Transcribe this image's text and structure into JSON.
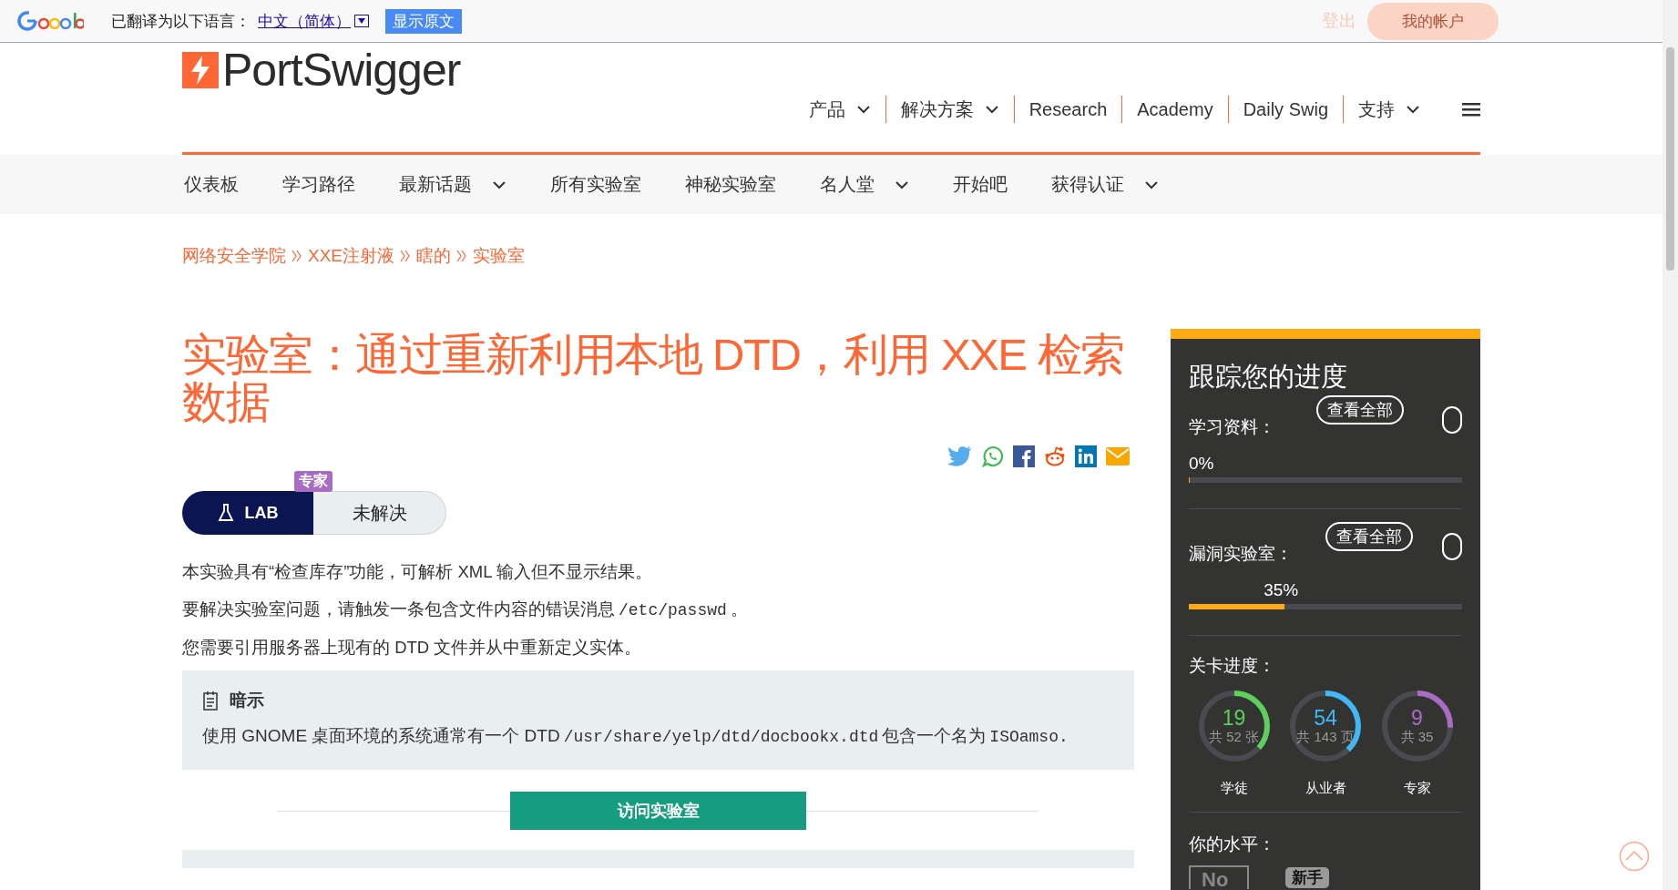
{
  "translate_bar": {
    "label": "已翻译为以下语言：",
    "language": "中文（简体）",
    "show_original_button": "显示原文"
  },
  "account": {
    "logout": "登出",
    "my_account": "我的帐户"
  },
  "logo": {
    "text": "PortSwigger"
  },
  "main_nav": [
    {
      "label": "产品",
      "dropdown": true
    },
    {
      "label": "解决方案",
      "dropdown": true
    },
    {
      "label": "Research",
      "dropdown": false
    },
    {
      "label": "Academy",
      "dropdown": false
    },
    {
      "label": "Daily Swig",
      "dropdown": false
    },
    {
      "label": "支持",
      "dropdown": true
    }
  ],
  "sub_nav": [
    {
      "label": "仪表板",
      "dropdown": false
    },
    {
      "label": "学习路径",
      "dropdown": false
    },
    {
      "label": "最新话题",
      "dropdown": true
    },
    {
      "label": "所有实验室",
      "dropdown": false
    },
    {
      "label": "神秘实验室",
      "dropdown": false
    },
    {
      "label": "名人堂",
      "dropdown": true
    },
    {
      "label": "开始吧",
      "dropdown": false
    },
    {
      "label": "获得认证",
      "dropdown": true
    }
  ],
  "breadcrumb": [
    "网络安全学院",
    "XXE注射液",
    "瞎的",
    "实验室"
  ],
  "title": "实验室：通过重新利用本地 DTD，利用 XXE 检索数据",
  "lab_status": {
    "badge": "专家",
    "label": "LAB",
    "status": "未解决"
  },
  "paragraphs": [
    [
      {
        "kind": "text",
        "text": "本实验具有“检查库存”功能，可解析 XML 输入但不显示结果。"
      }
    ],
    [
      {
        "kind": "text",
        "text": "要解决实验室问题，请触发一条包含文件内容的错误消息"
      },
      {
        "kind": "code",
        "text": "/etc/passwd"
      },
      {
        "kind": "text",
        "text": "。"
      }
    ],
    [
      {
        "kind": "text",
        "text": "您需要引用服务器上现有的 DTD 文件并从中重新定义实体。"
      }
    ]
  ],
  "hint": {
    "title": "暗示",
    "text": [
      {
        "kind": "text",
        "text": "使用 GNOME 桌面环境的系统通常有一个 DTD"
      },
      {
        "kind": "code",
        "text": "/usr/share/yelp/dtd/docbookx.dtd"
      },
      {
        "kind": "text",
        "text": "包含一个名为"
      },
      {
        "kind": "code",
        "text": "ISOamso."
      }
    ]
  },
  "access_button": "访问实验室",
  "progress": {
    "title": "跟踪您的进度",
    "sections": [
      {
        "label": "学习资料：",
        "view_all": "查看全部",
        "reading": "0%",
        "level": 0
      },
      {
        "label": "漏洞实验室：",
        "view_all": "查看全部",
        "reading": "35%",
        "level": 0.35
      }
    ],
    "levels_title": "关卡进度：",
    "levels": [
      {
        "count": "19",
        "total": "共 52 张",
        "name": "学徒",
        "level": 0.365,
        "color": "#5ccf5c"
      },
      {
        "count": "54",
        "total": "共 143 页",
        "name": "从业者",
        "level": 0.378,
        "color": "#3fb8f5"
      },
      {
        "count": "9",
        "total": "共 35",
        "name": "专家",
        "level": 0.257,
        "color": "#a86cc4"
      }
    ],
    "your_level_title": "你的水平：",
    "level_icon_text": "No",
    "level_badge": "新手"
  }
}
